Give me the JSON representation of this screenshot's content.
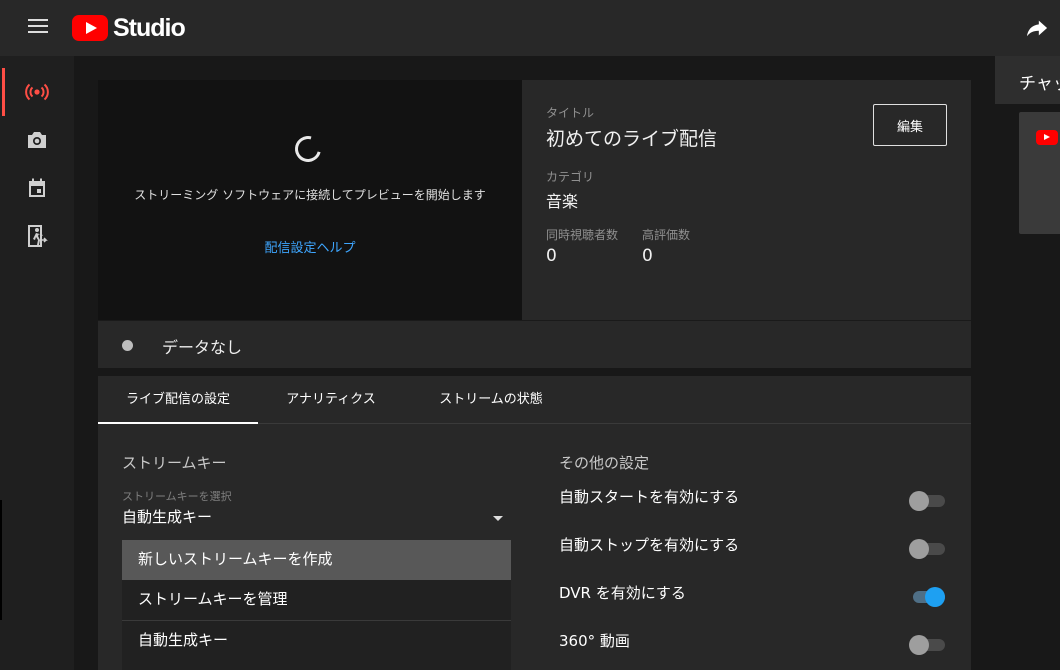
{
  "app": {
    "logo_text": "Studio",
    "brand_color": "#ff0000",
    "accent_link_color": "#3ea6ff"
  },
  "rail": {
    "items": [
      {
        "icon": "live-broadcast-icon",
        "active": true
      },
      {
        "icon": "camera-icon",
        "active": false
      },
      {
        "icon": "calendar-icon",
        "active": false
      },
      {
        "icon": "manage-exit-icon",
        "active": false
      }
    ]
  },
  "preview": {
    "message": "ストリーミング ソフトウェアに接続してプレビューを開始します",
    "help_link": "配信設定ヘルプ"
  },
  "info": {
    "title_label": "タイトル",
    "title": "初めてのライブ配信",
    "category_label": "カテゴリ",
    "category": "音楽",
    "viewers_label": "同時視聴者数",
    "viewers": "0",
    "likes_label": "高評価数",
    "likes": "0",
    "edit_button": "編集"
  },
  "status": {
    "text": "データなし"
  },
  "tabs": [
    {
      "label": "ライブ配信の設定",
      "active": true
    },
    {
      "label": "アナリティクス",
      "active": false
    },
    {
      "label": "ストリームの状態",
      "active": false
    }
  ],
  "stream_key": {
    "section_title": "ストリームキー",
    "select_label": "ストリームキーを選択",
    "select_value": "自動生成キー",
    "dropdown_options": [
      "新しいストリームキーを作成",
      "ストリームキーを管理",
      "自動生成キー"
    ]
  },
  "other_settings": {
    "section_title": "その他の設定",
    "options": [
      {
        "label": "自動スタートを有効にする",
        "enabled": false
      },
      {
        "label": "自動ストップを有効にする",
        "enabled": false
      },
      {
        "label": "DVR を有効にする",
        "enabled": true
      },
      {
        "label": "360° 動画",
        "enabled": false
      }
    ]
  },
  "chat": {
    "title": "チャット"
  }
}
